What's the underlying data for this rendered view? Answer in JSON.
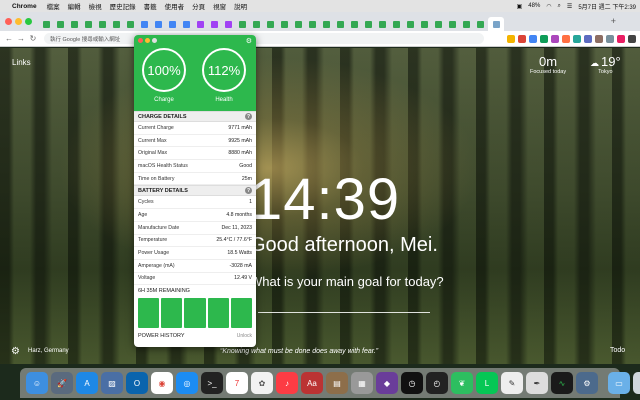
{
  "menubar": {
    "app_name": "Chrome",
    "menu_items": [
      "檔案",
      "編輯",
      "檢視",
      "歷史記錄",
      "書籤",
      "使用者",
      "分頁",
      "視窗",
      "說明"
    ],
    "battery_pct": "48%",
    "clock": "5月7日 週二 下午2:39"
  },
  "toolbar": {
    "address": "執行 Google 搜尋或輸入網址"
  },
  "newtab": {
    "links_label": "Links",
    "focus_value": "0m",
    "focus_label": "Focused today",
    "temperature": "19°",
    "city": "Tokyo",
    "clock": "14:39",
    "greeting": "Good afternoon, Mei.",
    "goal_question": "What is your main goal for today?",
    "location": "Harz, Germany",
    "quote": "“Knowing what must be done does away with fear.”",
    "todo_label": "Todo"
  },
  "battery_app": {
    "charge_value": "100%",
    "charge_label": "Charge",
    "health_value": "112%",
    "health_label": "Health",
    "charge_details_header": "CHARGE DETAILS",
    "charge_rows": [
      {
        "label": "Current Charge",
        "value": "9771 mAh"
      },
      {
        "label": "Current Max",
        "value": "9925 mAh"
      },
      {
        "label": "Original Max",
        "value": "8880 mAh"
      },
      {
        "label": "macOS Health Status",
        "value": "Good"
      },
      {
        "label": "Time on Battery",
        "value": "25m"
      }
    ],
    "battery_details_header": "BATTERY DETAILS",
    "battery_rows": [
      {
        "label": "Cycles",
        "value": "1"
      },
      {
        "label": "Age",
        "value": "4.8 months"
      },
      {
        "label": "Manufacture Date",
        "value": "Dec 11, 2023"
      },
      {
        "label": "Temperature",
        "value": "25.4°C / 77.6°F"
      },
      {
        "label": "Power Usage",
        "value": "18.5 Watts"
      },
      {
        "label": "Amperage (mA)",
        "value": "-3028 mA"
      },
      {
        "label": "Voltage",
        "value": "12.49 V"
      }
    ],
    "remaining": "6H 35M REMAINING",
    "power_history_label": "POWER HISTORY",
    "unlock_label": "Unlock"
  },
  "colors": {
    "accent_green": "#2db84d"
  }
}
